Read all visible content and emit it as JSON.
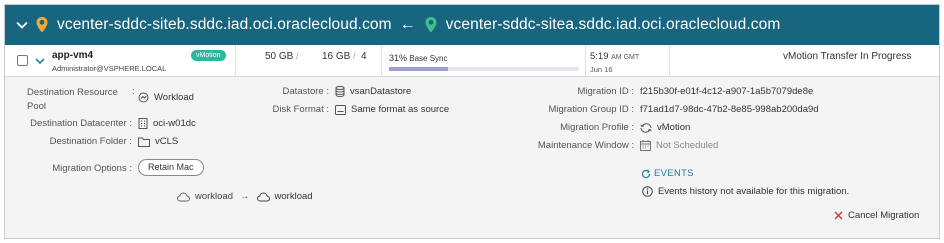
{
  "header": {
    "source_site": "vcenter-sddc-siteb.sddc.iad.oci.oraclecloud.com",
    "arrow": "←",
    "target_site": "vcenter-sddc-sitea.sddc.iad.oci.oraclecloud.com"
  },
  "migration_row": {
    "vm_name": "app-vm4",
    "owner": "Administrator@VSPHERE.LOCAL",
    "badge": "vMotion",
    "size_1": "50 GB",
    "size_2": "16 GB",
    "size_sep": "/",
    "count": "4",
    "progress_pct": "31%",
    "progress_label": "Base Sync",
    "progress_value": 31,
    "time": "5:19",
    "time_suffix": "AM GMT",
    "date": "Jun 16",
    "status": "vMotion Transfer In Progress"
  },
  "details": {
    "dest_resource_pool_label": "Destination Resource Pool",
    "dest_resource_pool_value": "Workload",
    "dest_datacenter_label": "Destination Datacenter :",
    "dest_datacenter_value": "oci-w01dc",
    "dest_folder_label": "Destination Folder :",
    "dest_folder_value": "vCLS",
    "migration_options_label": "Migration Options :",
    "retain_mac_button": "Retain Mac",
    "network_source": "workload",
    "network_arrow": "→",
    "network_target": "workload",
    "datastore_label": "Datastore :",
    "datastore_value": "vsanDatastore",
    "disk_format_label": "Disk Format :",
    "disk_format_value": "Same format as source",
    "migration_id_label": "Migration ID :",
    "migration_id_value": "f215b30f-e01f-4c12-a907-1a5b7079de8e",
    "migration_group_id_label": "Migration Group ID :",
    "migration_group_id_value": "f71ad1d7-98dc-47b2-8e85-998ab200da9d",
    "migration_profile_label": "Migration Profile :",
    "migration_profile_value": "vMotion",
    "maintenance_window_label": "Maintenance Window :",
    "maintenance_window_value": "Not Scheduled",
    "events_link": "EVENTS",
    "events_info": "Events history not available for this migration.",
    "cancel_migration": "Cancel Migration"
  },
  "colors": {
    "header_bg": "#17657f",
    "badge_bg": "#2fb79b",
    "progress_fill": "#9a9fd0",
    "link": "#1e7fa8",
    "cancel_x": "#d9342b"
  }
}
